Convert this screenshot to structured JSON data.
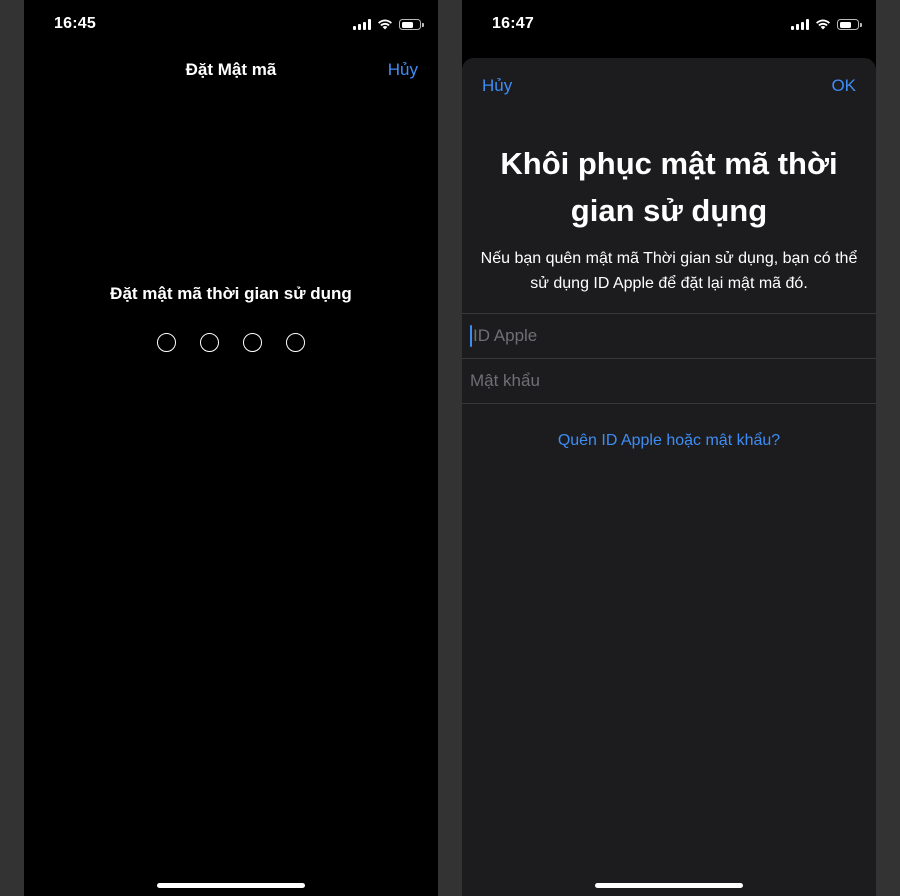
{
  "left_screen": {
    "status_time": "16:45",
    "nav_title": "Đặt Mật mã",
    "cancel_label": "Hủy",
    "prompt": "Đặt mật mã thời gian sử dụng",
    "passcode_length": 4
  },
  "right_screen": {
    "status_time": "16:47",
    "cancel_label": "Hủy",
    "ok_label": "OK",
    "title": "Khôi phục mật mã thời gian sử dụng",
    "description": "Nếu bạn quên mật mã Thời gian sử dụng, bạn có thể sử dụng ID Apple để đặt lại mật mã đó.",
    "apple_id_field": {
      "value": "",
      "placeholder": "ID Apple"
    },
    "password_field": {
      "value": "",
      "placeholder": "Mật khẩu"
    },
    "forgot_link": "Quên ID Apple hoặc mật khẩu?"
  },
  "colors": {
    "accent": "#3e8df5",
    "screen_background": "#000000",
    "sheet_background": "#1c1c1e",
    "page_background": "#333333"
  },
  "icons": [
    "cellular-signal-icon",
    "wifi-icon",
    "battery-icon"
  ]
}
